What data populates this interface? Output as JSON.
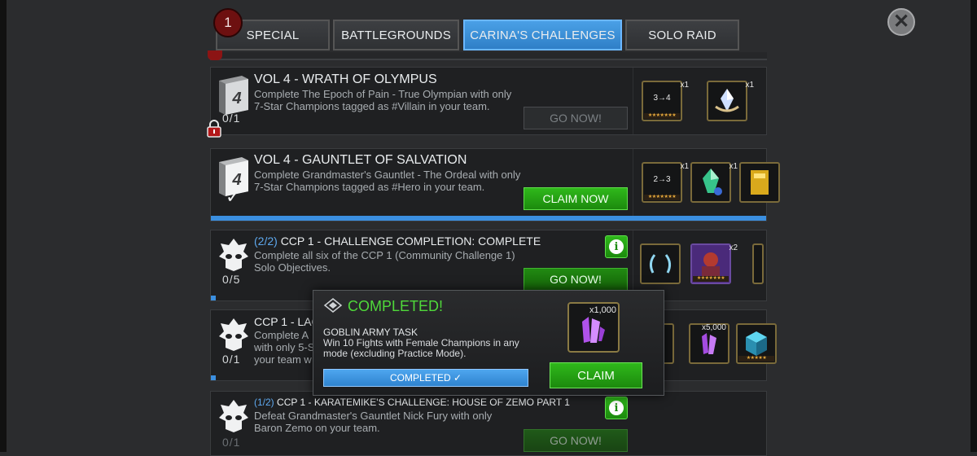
{
  "tabs": {
    "badge": "1",
    "items": [
      {
        "label": "SPECIAL"
      },
      {
        "label": "BATTLEGROUNDS"
      },
      {
        "label": "CARINA'S CHALLENGES"
      },
      {
        "label": "SOLO RAID"
      }
    ],
    "active": "CARINA'S CHALLENGES"
  },
  "close_icon": "close-x-icon",
  "quests": [
    {
      "title": "VOL 4 - WRATH OF OLYMPUS",
      "desc": "Complete The Epoch of Pain - True Olympian with only 7-Star Champions tagged as #Villain in your team.",
      "progress": "0/1",
      "button": "GO NOW!",
      "book_number": "4",
      "rewards": [
        {
          "label": "3→4",
          "qty": "x1"
        },
        {
          "label": "",
          "qty": "x1"
        }
      ]
    },
    {
      "title": "VOL 4 - GAUNTLET OF SALVATION",
      "desc": "Complete Grandmaster's Gauntlet - The Ordeal with only 7-Star Champions tagged as #Hero in your team.",
      "button": "CLAIM NOW",
      "book_number": "4",
      "check": "✓",
      "rewards": [
        {
          "label": "2→3",
          "qty": "x1"
        },
        {
          "label": "",
          "qty": "x1"
        },
        {
          "label": "",
          "qty": ""
        }
      ]
    },
    {
      "fraction": "(2/2)",
      "title": "CCP 1 - CHALLENGE COMPLETION: COMPLETE",
      "desc": "Complete all six of the CCP 1 (Community Challenge 1) Solo Objectives.",
      "progress": "0/5",
      "button": "GO NOW!",
      "rewards": [
        {
          "label": "",
          "qty": ""
        },
        {
          "label": "",
          "qty": "x2"
        }
      ]
    },
    {
      "title": "CCP 1 - LAGA",
      "desc_lines": [
        "Complete A",
        "with only 5-S",
        "your team w"
      ],
      "progress": "0/1",
      "rewards": [
        {
          "label": "",
          "qty": ""
        },
        {
          "label": "",
          "qty": "x5,000"
        },
        {
          "label": "",
          "qty": ""
        }
      ]
    },
    {
      "fraction": "(1/2)",
      "title": "CCP 1 - KARATEMIKE'S CHALLENGE: HOUSE OF ZEMO PART 1",
      "desc": "Defeat Grandmaster's Gauntlet Nick Fury with only Baron Zemo on your team.",
      "progress": "0/1",
      "button": "GO NOW!"
    }
  ],
  "popup": {
    "title": "COMPLETED!",
    "task": "GOBLIN ARMY TASK",
    "desc": "Win 10 Fights with Female Champions in any mode (excluding Practice Mode).",
    "bar_label": "COMPLETED",
    "bar_check": "✓",
    "reward_qty": "x1,000",
    "claim": "CLAIM"
  },
  "colors": {
    "accent_blue": "#3b8fe0",
    "claim_green": "#2fb81b",
    "completed_green": "#4fd93a",
    "lock_red": "#8c1414"
  }
}
